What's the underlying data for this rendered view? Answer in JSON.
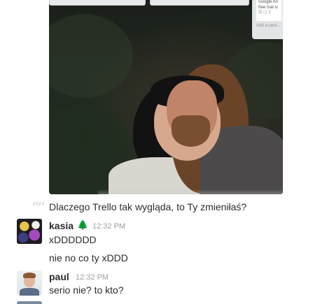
{
  "attachment": {
    "trello_card_title_1": "",
    "trello_card_snippet": "Google An free trial si",
    "trello_card_meta": "☰ ▢ 2",
    "trello_add_card": "Add a card..."
  },
  "quote": {
    "icon": "quote-icon",
    "text": "Dlaczego Trello tak wygląda, to Ty zmieniłaś?"
  },
  "messages": [
    {
      "author": "kasia",
      "status_emoji": "🌲",
      "time": "12:32 PM",
      "lines": [
        "xDDDDDD",
        "nie no co ty xDDD"
      ]
    },
    {
      "author": "paul",
      "time": "12:32 PM",
      "lines": [
        "serio nie? to kto?"
      ]
    }
  ]
}
